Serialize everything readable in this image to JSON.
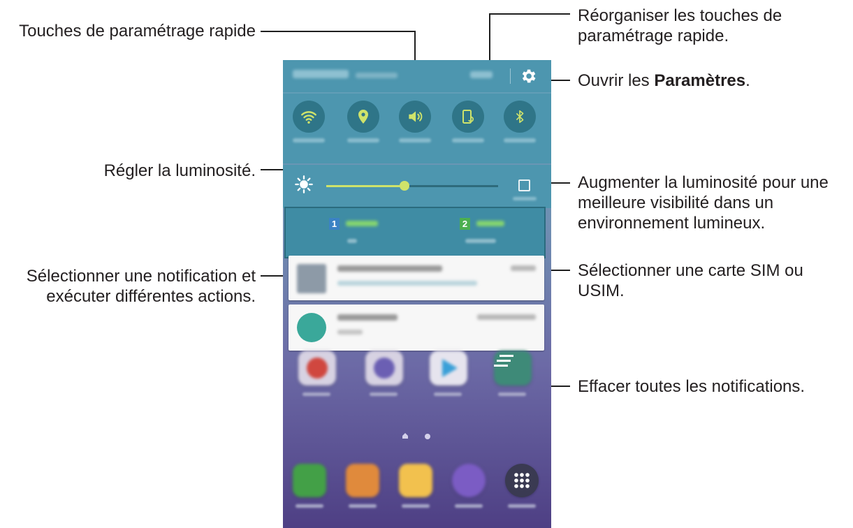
{
  "callouts": {
    "quick_settings": "Touches de paramétrage rapide",
    "brightness": "Régler la luminosité.",
    "select_notification": [
      "Sélectionner une notification et",
      "exécuter différentes actions."
    ],
    "reorganise": [
      "Réorganiser les touches de",
      "paramétrage rapide."
    ],
    "open_settings_prefix": "Ouvrir les ",
    "open_settings_bold": "Paramètres",
    "open_settings_suffix": ".",
    "outdoor": [
      "Augmenter la luminosité pour une",
      "meilleure visibilité dans un",
      "environnement lumineux."
    ],
    "sim": [
      "Sélectionner une carte SIM ou",
      "USIM."
    ],
    "clear_all": "Effacer toutes les notifications."
  },
  "phone": {
    "quick_settings": [
      {
        "icon": "wifi-icon"
      },
      {
        "icon": "location-icon"
      },
      {
        "icon": "sound-icon"
      },
      {
        "icon": "screen-rotation-icon"
      },
      {
        "icon": "bluetooth-icon"
      }
    ],
    "sim_cards": [
      {
        "number": "1"
      },
      {
        "number": "2"
      }
    ]
  },
  "colors": {
    "panel": "#4d96af",
    "accent": "#cfe36a",
    "sim1": "#3b82c4",
    "sim2": "#4caf50"
  }
}
